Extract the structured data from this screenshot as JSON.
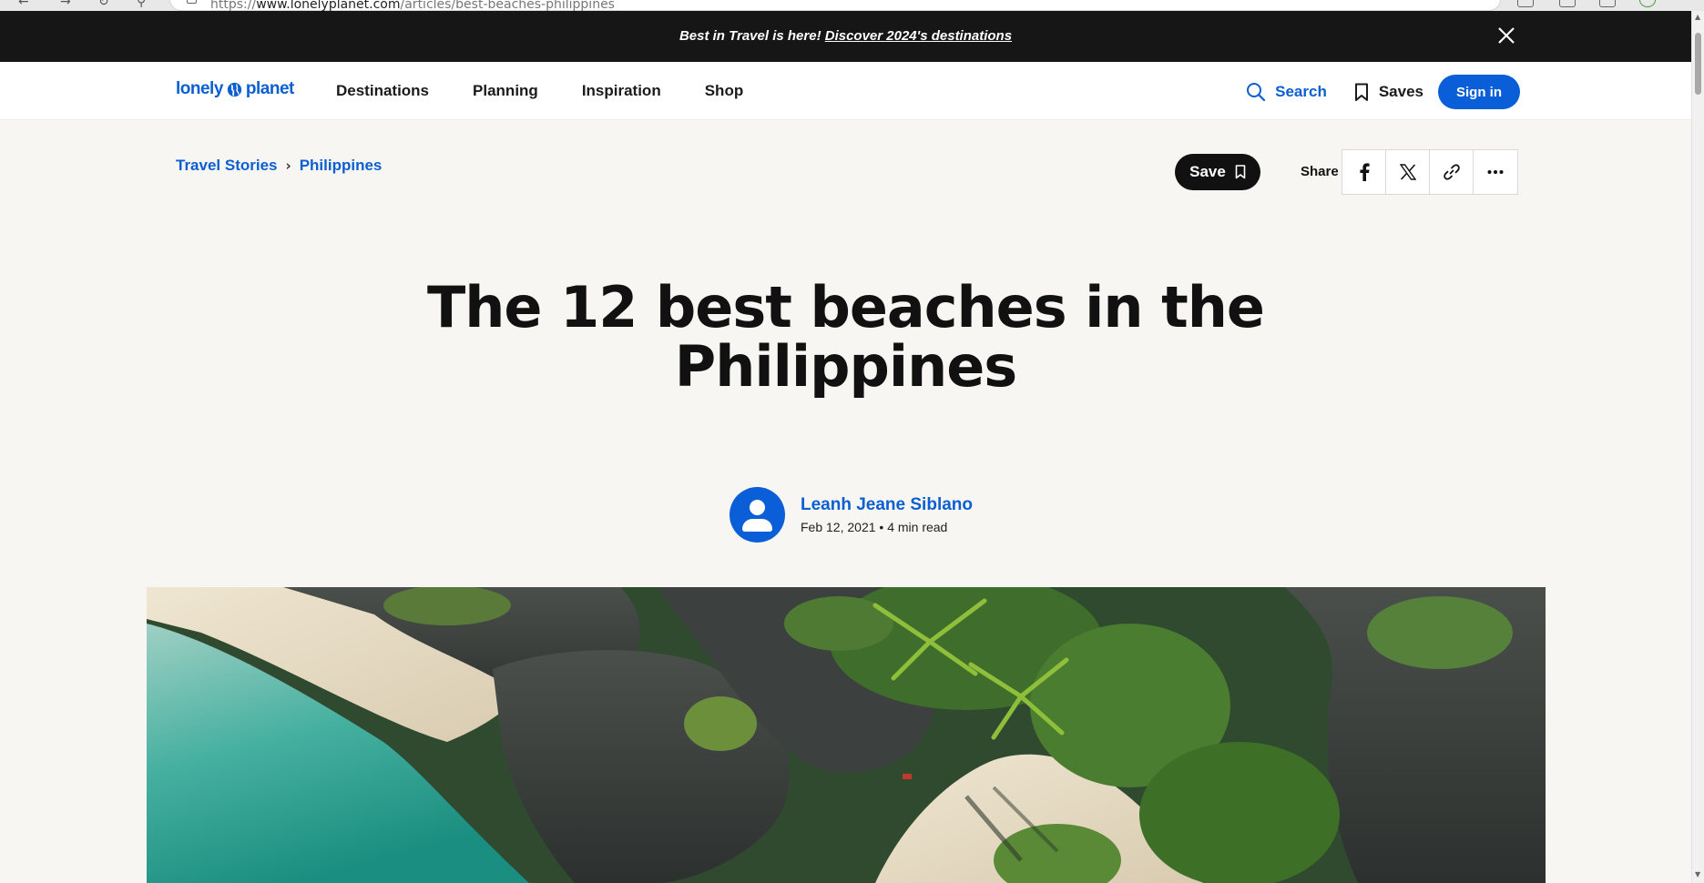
{
  "browser": {
    "url_prefix": "https://",
    "url_domain": "www.lonelyplanet.com",
    "url_path": "/articles/best-beaches-philippines"
  },
  "promo": {
    "lead": "Best in Travel is here!",
    "link": "Discover 2024's destinations"
  },
  "header": {
    "logo_left": "lonely",
    "logo_right": "planet",
    "nav": [
      "Destinations",
      "Planning",
      "Inspiration",
      "Shop"
    ],
    "search_label": "Search",
    "saves_label": "Saves",
    "signin_label": "Sign in"
  },
  "breadcrumb": {
    "items": [
      "Travel Stories",
      "Philippines"
    ]
  },
  "actions": {
    "save_label": "Save",
    "share_label": "Share",
    "share_buttons": [
      "facebook-icon",
      "x-icon",
      "link-icon",
      "more-icon"
    ]
  },
  "article": {
    "title_line1": "The 12 best beaches in the",
    "title_line2": "Philippines",
    "author": "Leanh Jeane Siblano",
    "meta": "Feb 12, 2021 • 4 min read"
  },
  "colors": {
    "brand_blue": "#0a5fd8",
    "banner_black": "#161616",
    "page_bg": "#f7f6f3"
  }
}
